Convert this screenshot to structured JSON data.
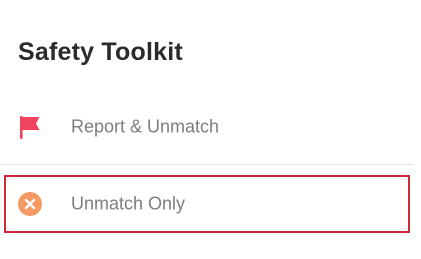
{
  "header": {
    "title": "Safety Toolkit"
  },
  "options": [
    {
      "label": "Report & Unmatch",
      "icon": "flag-icon",
      "icon_color": "#f0455f"
    },
    {
      "label": "Unmatch Only",
      "icon": "close-circle-icon",
      "icon_color": "#f59a63"
    }
  ],
  "colors": {
    "title": "#2b2b2b",
    "label": "#7d7d7d",
    "highlight": "#cc2a36"
  }
}
